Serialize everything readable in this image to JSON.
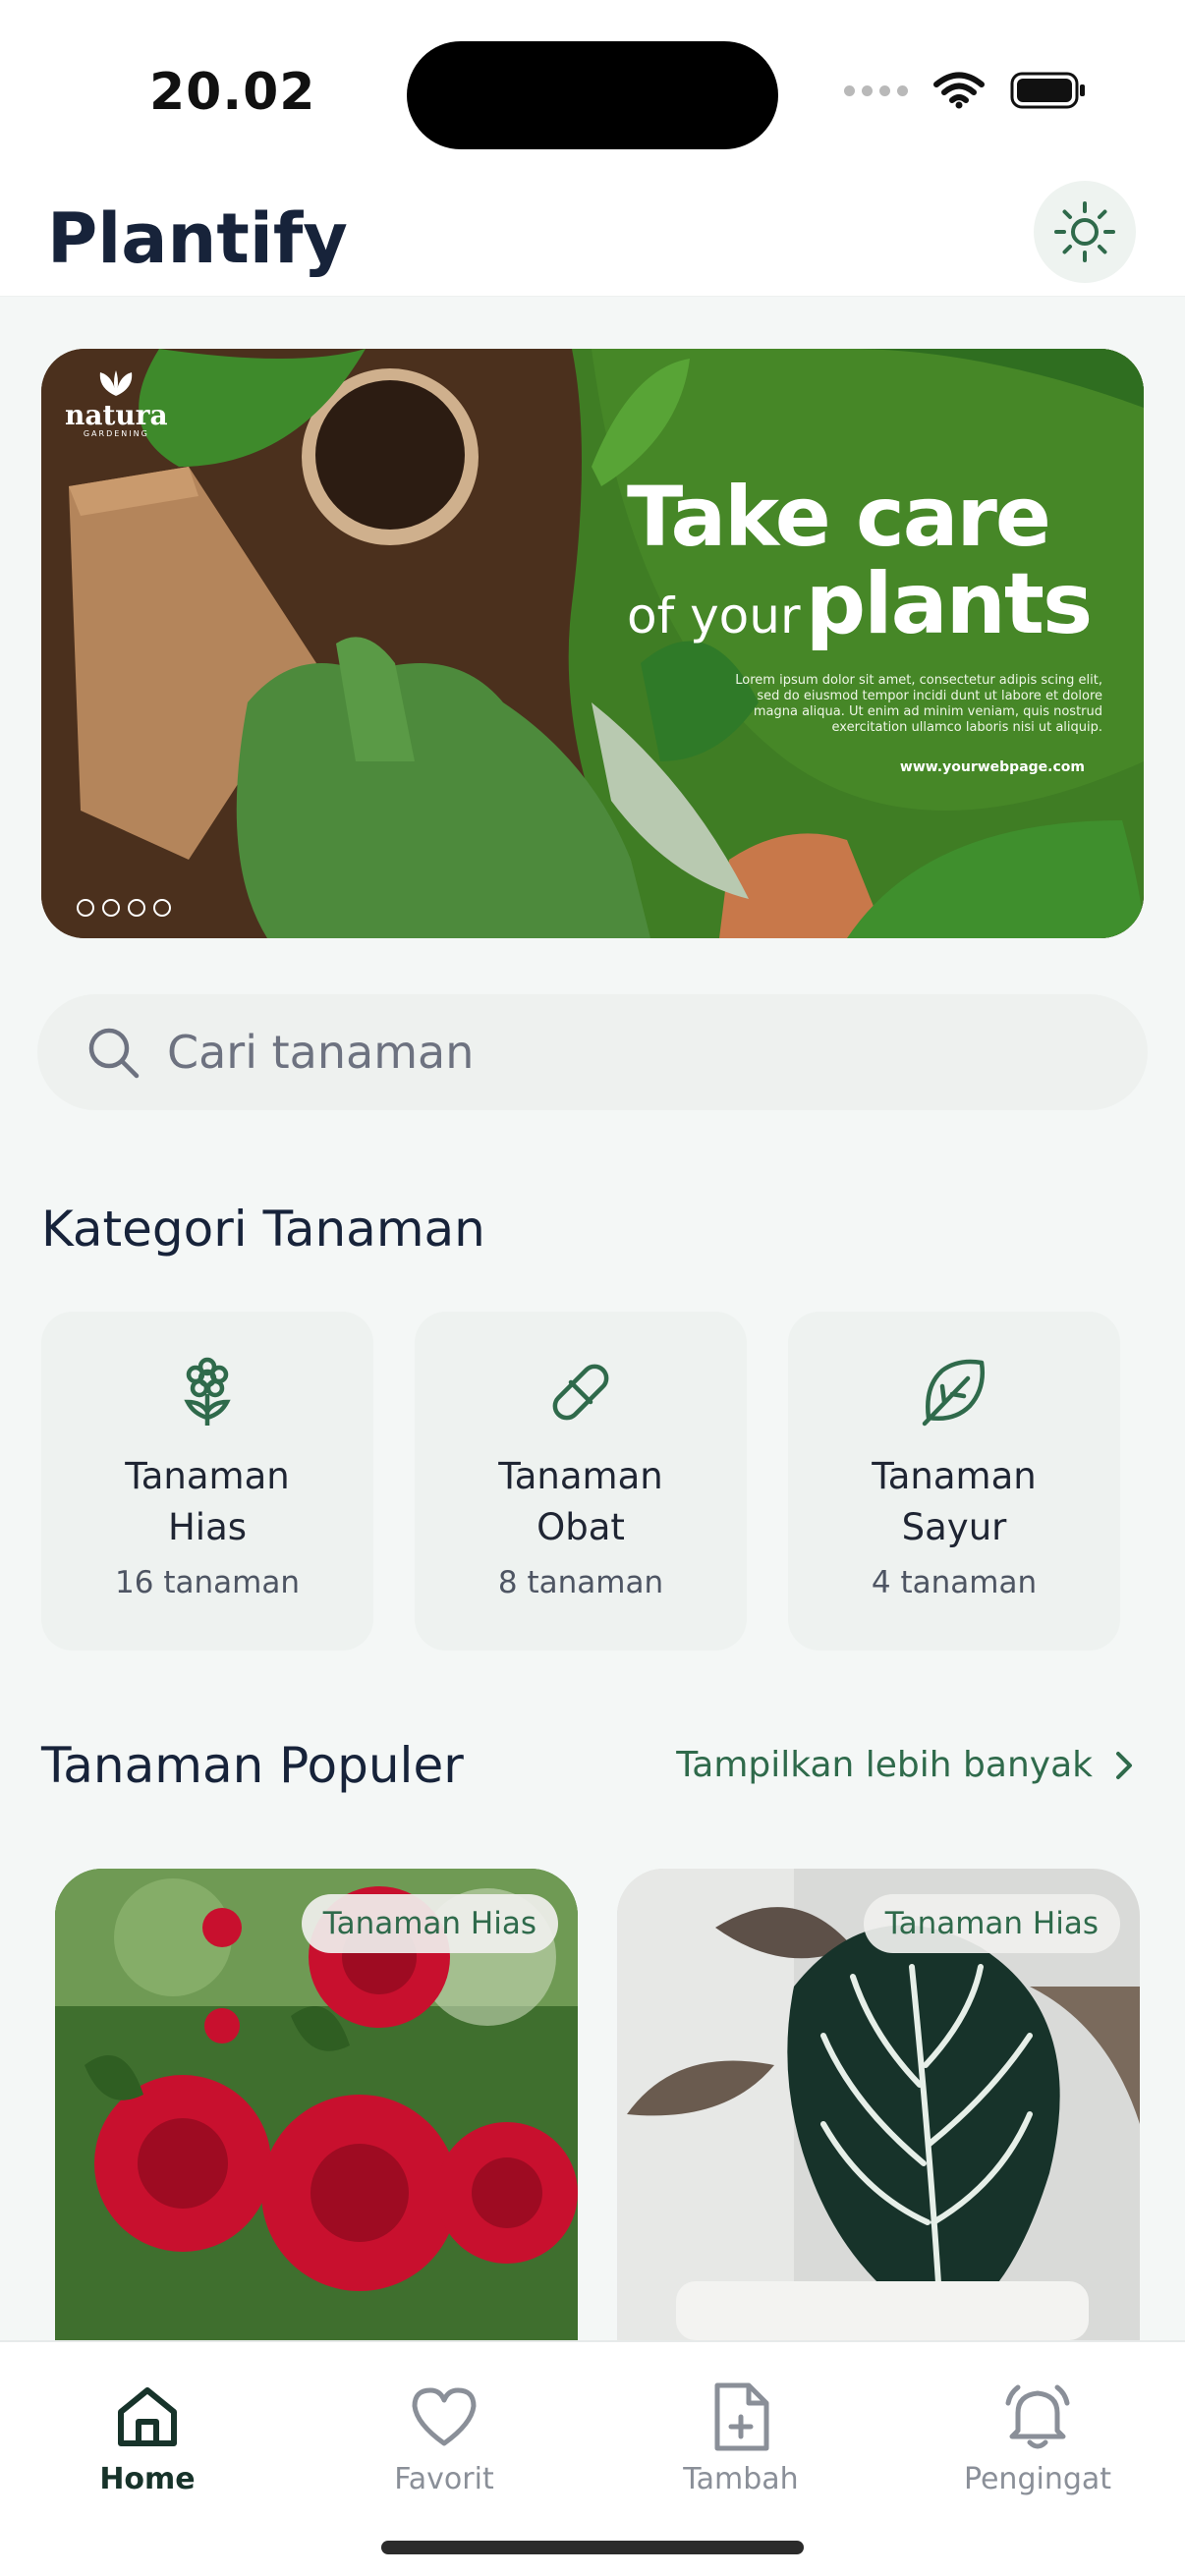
{
  "status_bar": {
    "time": "20.02"
  },
  "header": {
    "title": "Plantify",
    "theme_icon": "sun-icon"
  },
  "banner": {
    "brand": "natura",
    "brand_sub": "GARDENING",
    "headline_1": "Take care",
    "headline_2_small": "of your",
    "headline_2_big": "plants",
    "body": "Lorem ipsum dolor sit amet, consectetur adipis scing elit, sed do eiusmod tempor incidi dunt ut labore et dolore magna aliqua. Ut enim ad minim veniam, quis nostrud exercitation ullamco laboris nisi ut aliquip.",
    "url": "www.yourwebpage.com"
  },
  "search": {
    "placeholder": "Cari tanaman",
    "icon": "search-icon"
  },
  "categories_section": {
    "title": "Kategori Tanaman",
    "items": [
      {
        "name_line1": "Tanaman",
        "name_line2": "Hias",
        "count": "16 tanaman",
        "icon": "flower-icon"
      },
      {
        "name_line1": "Tanaman",
        "name_line2": "Obat",
        "count": "8 tanaman",
        "icon": "pill-icon"
      },
      {
        "name_line1": "Tanaman",
        "name_line2": "Sayur",
        "count": "4 tanaman",
        "icon": "leaf-icon"
      }
    ]
  },
  "popular_section": {
    "title": "Tanaman Populer",
    "see_more": "Tampilkan lebih banyak",
    "items": [
      {
        "badge": "Tanaman Hias",
        "image": "red-roses"
      },
      {
        "badge": "Tanaman Hias",
        "image": "alocasia-leaf"
      }
    ]
  },
  "tab_bar": {
    "active": "Home",
    "items": [
      {
        "label": "Home",
        "icon": "home-icon"
      },
      {
        "label": "Favorit",
        "icon": "heart-icon"
      },
      {
        "label": "Tambah",
        "icon": "add-file-icon"
      },
      {
        "label": "Pengingat",
        "icon": "bell-icon"
      }
    ]
  },
  "colors": {
    "primary": "#2f6a4b",
    "text": "#17233a",
    "background": "#f4f7f6"
  }
}
